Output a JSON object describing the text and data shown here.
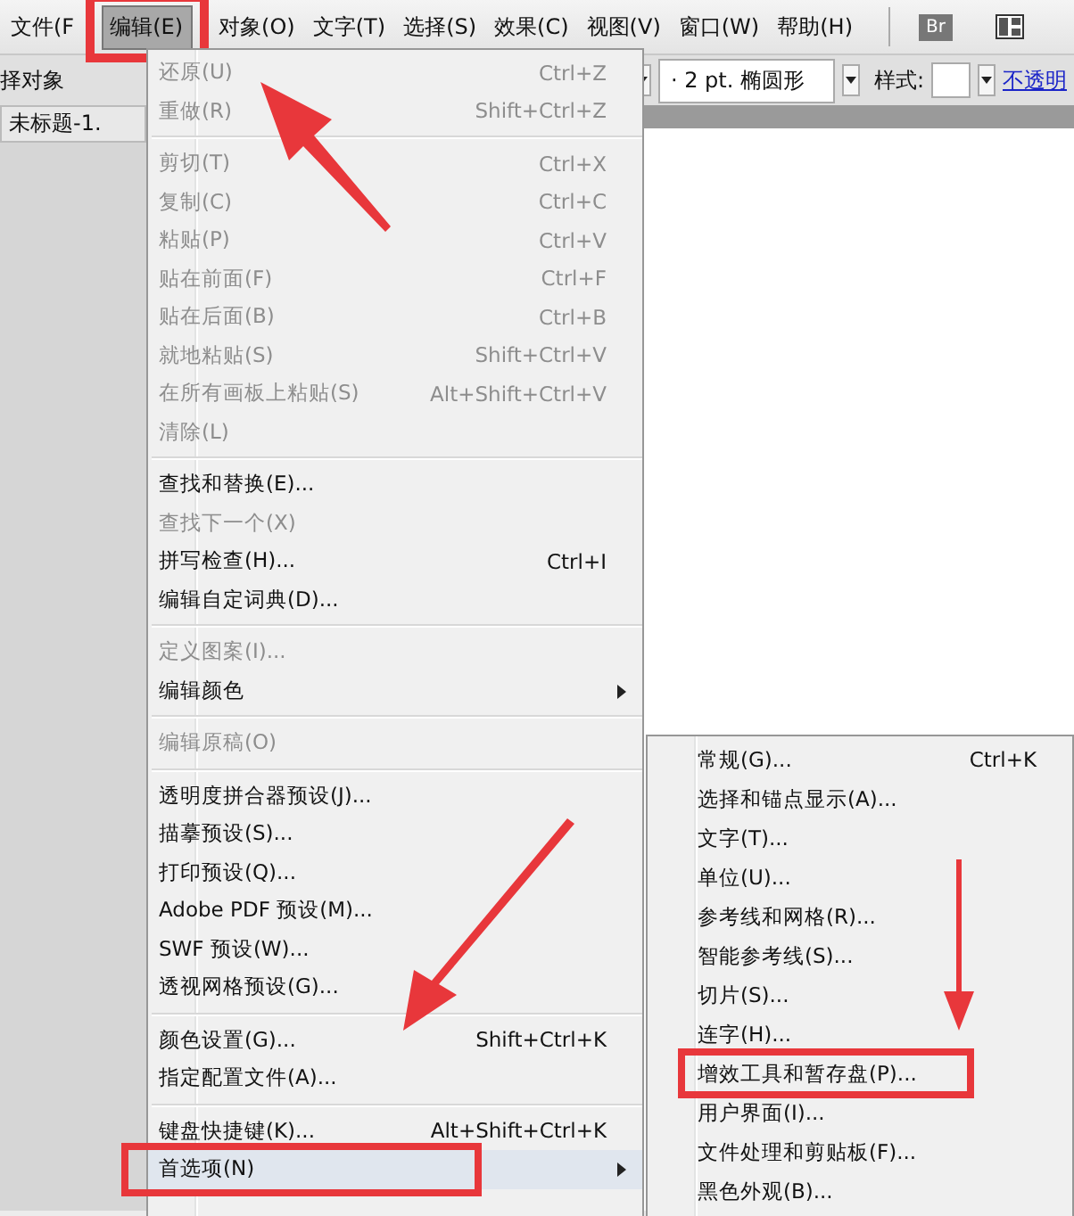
{
  "menubar": [
    {
      "label": "文件(F",
      "selected": false
    },
    {
      "label": "编辑(E)",
      "selected": true
    },
    {
      "label": "对象(O)",
      "selected": false
    },
    {
      "label": "文字(T)",
      "selected": false
    },
    {
      "label": "选择(S)",
      "selected": false
    },
    {
      "label": "效果(C)",
      "selected": false
    },
    {
      "label": "视图(V)",
      "selected": false
    },
    {
      "label": "窗口(W)",
      "selected": false
    },
    {
      "label": "帮助(H)",
      "selected": false
    }
  ],
  "bridge_button": "Br",
  "toolbar": {
    "selection_label": "择对象",
    "brush": "·  2 pt. 椭圆形",
    "style_label": "样式:",
    "opacity_link": "不透明"
  },
  "document_tab": "未标题-1.",
  "edit_menu": [
    {
      "kind": "item",
      "label": "还原(U)",
      "shortcut": "Ctrl+Z",
      "disabled": true,
      "submenu": false,
      "selected": false
    },
    {
      "kind": "item",
      "label": "重做(R)",
      "shortcut": "Shift+Ctrl+Z",
      "disabled": true,
      "submenu": false,
      "selected": false
    },
    {
      "kind": "separator"
    },
    {
      "kind": "item",
      "label": "剪切(T)",
      "shortcut": "Ctrl+X",
      "disabled": true,
      "submenu": false,
      "selected": false
    },
    {
      "kind": "item",
      "label": "复制(C)",
      "shortcut": "Ctrl+C",
      "disabled": true,
      "submenu": false,
      "selected": false
    },
    {
      "kind": "item",
      "label": "粘贴(P)",
      "shortcut": "Ctrl+V",
      "disabled": true,
      "submenu": false,
      "selected": false
    },
    {
      "kind": "item",
      "label": "贴在前面(F)",
      "shortcut": "Ctrl+F",
      "disabled": true,
      "submenu": false,
      "selected": false
    },
    {
      "kind": "item",
      "label": "贴在后面(B)",
      "shortcut": "Ctrl+B",
      "disabled": true,
      "submenu": false,
      "selected": false
    },
    {
      "kind": "item",
      "label": "就地粘贴(S)",
      "shortcut": "Shift+Ctrl+V",
      "disabled": true,
      "submenu": false,
      "selected": false
    },
    {
      "kind": "item",
      "label": "在所有画板上粘贴(S)",
      "shortcut": "Alt+Shift+Ctrl+V",
      "disabled": true,
      "submenu": false,
      "selected": false
    },
    {
      "kind": "item",
      "label": "清除(L)",
      "disabled": true,
      "submenu": false,
      "selected": false
    },
    {
      "kind": "separator"
    },
    {
      "kind": "item",
      "label": "查找和替换(E)...",
      "disabled": false,
      "submenu": false,
      "selected": false
    },
    {
      "kind": "item",
      "label": "查找下一个(X)",
      "disabled": true,
      "submenu": false,
      "selected": false
    },
    {
      "kind": "item",
      "label": "拼写检查(H)...",
      "shortcut": "Ctrl+I",
      "disabled": false,
      "submenu": false,
      "selected": false
    },
    {
      "kind": "item",
      "label": "编辑自定词典(D)...",
      "disabled": false,
      "submenu": false,
      "selected": false
    },
    {
      "kind": "separator"
    },
    {
      "kind": "item",
      "label": "定义图案(I)...",
      "disabled": true,
      "submenu": false,
      "selected": false
    },
    {
      "kind": "item",
      "label": "编辑颜色",
      "disabled": false,
      "submenu": true,
      "selected": false
    },
    {
      "kind": "separator"
    },
    {
      "kind": "item",
      "label": "编辑原稿(O)",
      "disabled": true,
      "submenu": false,
      "selected": false
    },
    {
      "kind": "separator"
    },
    {
      "kind": "item",
      "label": "透明度拼合器预设(J)...",
      "disabled": false,
      "submenu": false,
      "selected": false
    },
    {
      "kind": "item",
      "label": "描摹预设(S)...",
      "disabled": false,
      "submenu": false,
      "selected": false
    },
    {
      "kind": "item",
      "label": "打印预设(Q)...",
      "disabled": false,
      "submenu": false,
      "selected": false
    },
    {
      "kind": "item",
      "label": "Adobe PDF 预设(M)...",
      "disabled": false,
      "submenu": false,
      "selected": false
    },
    {
      "kind": "item",
      "label": "SWF 预设(W)...",
      "disabled": false,
      "submenu": false,
      "selected": false
    },
    {
      "kind": "item",
      "label": "透视网格预设(G)...",
      "disabled": false,
      "submenu": false,
      "selected": false
    },
    {
      "kind": "separator"
    },
    {
      "kind": "item",
      "label": "颜色设置(G)...",
      "shortcut": "Shift+Ctrl+K",
      "disabled": false,
      "submenu": false,
      "selected": false
    },
    {
      "kind": "item",
      "label": "指定配置文件(A)...",
      "disabled": false,
      "submenu": false,
      "selected": false
    },
    {
      "kind": "separator"
    },
    {
      "kind": "item",
      "label": "键盘快捷键(K)...",
      "shortcut": "Alt+Shift+Ctrl+K",
      "disabled": false,
      "submenu": false,
      "selected": false
    },
    {
      "kind": "item",
      "label": "首选项(N)",
      "disabled": false,
      "submenu": true,
      "selected": true
    }
  ],
  "preferences_submenu": [
    {
      "label": "常规(G)...",
      "shortcut": "Ctrl+K"
    },
    {
      "label": "选择和锚点显示(A)..."
    },
    {
      "label": "文字(T)..."
    },
    {
      "label": "单位(U)..."
    },
    {
      "label": "参考线和网格(R)..."
    },
    {
      "label": "智能参考线(S)..."
    },
    {
      "label": "切片(S)..."
    },
    {
      "label": "连字(H)..."
    },
    {
      "label": "增效工具和暂存盘(P)..."
    },
    {
      "label": "用户界面(I)..."
    },
    {
      "label": "文件处理和剪贴板(F)..."
    },
    {
      "label": "黑色外观(B)..."
    }
  ]
}
